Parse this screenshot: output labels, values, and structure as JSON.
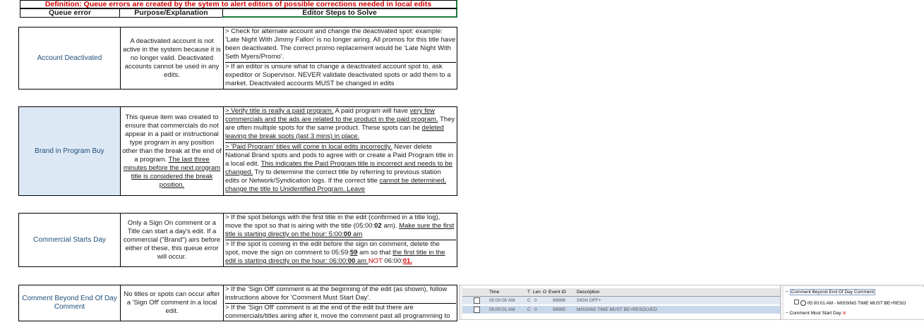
{
  "definition": "Definition: Queue errors are created by the sytem to alert editors of possible corrections needed in local edits",
  "headers": {
    "col1": "Queue error",
    "col2": "Purpose/Explanation",
    "col3": "Editor Steps to Solve"
  },
  "rows": [
    {
      "name": "Account Deactivated",
      "purpose": "A deactivated account is not active in the system because it is no longer valid. Deactivated accounts cannot be used in any edits.",
      "steps": [
        "> Check for alternate account and change the deactivated spot: example: 'Late Night With Jimmy Fallon' is no longer airing. All promos for this title have been deactivated. The correct promo replacement would be 'Late Night With Seth Myers/Promo'.",
        "> If an editor is unsure what to change a deactivated account spot to, ask expeditor or Supervisor. NEVER validate deactivated spots or add them to a market. Deactivated accounts MUST be changed in edits"
      ]
    },
    {
      "name": "Brand in Program Buy",
      "purpose_a": "This queue item was created to ensure that commercials do not appear in a paid or instructional type program in any position other than the break at the end of a program.",
      "purpose_b": "The last three minutes before the next program title is considered the break position.",
      "steps_a1": "> Verify title is really a paid program.",
      "steps_a2": " A paid program will have ",
      "steps_a3": "very few commercials and the ads are related to the product in the paid program.",
      "steps_a4": " They are often multiple spots for the same product. These spots can be ",
      "steps_a5": "deleted leaving the break spots (last 3 mins) in place.",
      "steps_b1": "> 'Paid Program' titles will come in local edits incorrectly.",
      "steps_b2": " Never delete National Brand spots and pods to agree with or create a Paid Program title in a local edit. ",
      "steps_b3": "This indicates the Paid Program title is incorrect and needs to be changed.",
      "steps_b4": " Try to determine the correct title by referring to previous station edits or Network/Syndication logs. If the correct title ",
      "steps_b5": "cannot be determined, change the title to Unidentified Program. Leave"
    },
    {
      "name": "Commercial Starts Day",
      "purpose": "Only a Sign On comment or a Title can start a day's edit. If a commercial (\"Brand\") airs before either of these, this queue error will occur.",
      "steps_a1": "> If the spot belongs with the first title in the edit (confirmed in a title log), move the spot so that is airing with the title (05:00:",
      "steps_a2": "02",
      "steps_a3": " am). ",
      "steps_a4": "Make sure the first title is starting directly on the hour: 5:00:",
      "steps_a5": "00",
      "steps_a6": " am",
      "steps_b1": "> If the spot is coming in the edit before the sign on comment, delete the spot, move the sign on comment to 05:59:",
      "steps_b2": "59",
      "steps_b3": " am so that ",
      "steps_b4": "the first title in the edit is starting directly on the hour: 06:00:",
      "steps_b5": "00",
      "steps_b6": " am ",
      "steps_b7": "NOT",
      "steps_b8": " 06:00:",
      "steps_b9": "01."
    },
    {
      "name": "Comment Beyond End Of Day Comment",
      "purpose": "No titles or spots can occur after a 'Sign Off' comment in a local edit.",
      "steps": [
        "> If the 'Sign Off' comment is at the beginning of the edit (as shown), follow instructions above for 'Comment Must Start Day'.",
        "> If the 'Sign Off' comment is at the end of the edit but there are commercials/titles airing after it, move the comment past all programming to"
      ]
    }
  ],
  "screenshot": {
    "columns": [
      "Time",
      "T",
      "Len",
      "O",
      "Event ID",
      "Description"
    ],
    "rows": [
      {
        "time": "05:00:00 AM",
        "t": "C",
        "len": "0",
        "event_id": "99996",
        "description": "SIGN OFF+"
      },
      {
        "time": "05:00:01 AM",
        "t": "C",
        "len": "0",
        "event_id": "99995",
        "description": "MISSING TIME MUST BE+RESOLVED"
      }
    ],
    "tree": {
      "item1": "Comment Beyond End Of Day Comment",
      "item2": "05:00:01 AM - MISSING TIME MUST BE+RESO",
      "item3": "Comment Must Start Day"
    }
  }
}
